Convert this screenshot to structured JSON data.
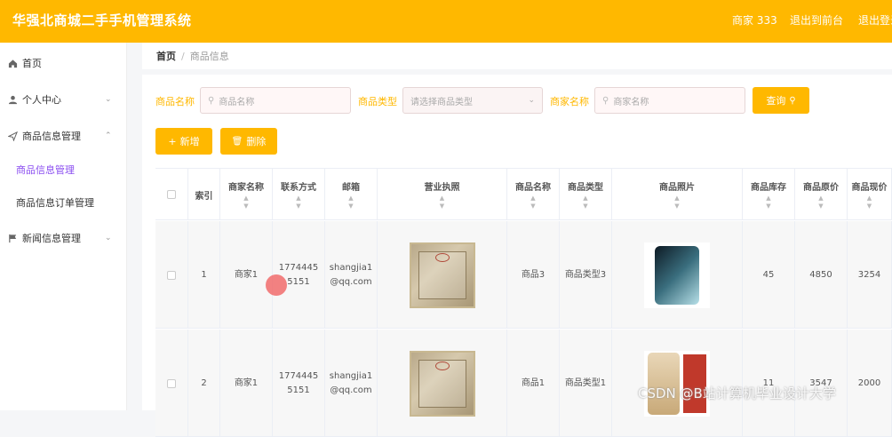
{
  "app": {
    "title": "华强北商城二手手机管理系统",
    "user_label": "商家 333",
    "front_label": "退出到前台",
    "logout_label": "退出登录"
  },
  "sidebar": {
    "items": [
      {
        "label": "首页",
        "icon": "home-icon"
      },
      {
        "label": "个人中心",
        "icon": "user-icon"
      },
      {
        "label": "商品信息管理",
        "icon": "send-icon"
      },
      {
        "label": "新闻信息管理",
        "icon": "flag-icon"
      }
    ],
    "sub_items": [
      {
        "label": "商品信息管理",
        "active": true
      },
      {
        "label": "商品信息订单管理",
        "active": false
      }
    ]
  },
  "breadcrumb": {
    "home": "首页",
    "sep": "/",
    "current": "商品信息"
  },
  "search": {
    "name_label": "商品名称",
    "name_placeholder": "商品名称",
    "type_label": "商品类型",
    "type_placeholder": "请选择商品类型",
    "merchant_label": "商家名称",
    "merchant_placeholder": "商家名称",
    "query_btn": "查询"
  },
  "actions": {
    "add_btn": "新增",
    "delete_btn": "删除"
  },
  "table": {
    "headers": [
      "索引",
      "商家名称",
      "联系方式",
      "邮箱",
      "营业执照",
      "商品名称",
      "商品类型",
      "商品照片",
      "商品库存",
      "商品原价",
      "商品现价"
    ],
    "rows": [
      {
        "index": "1",
        "merchant": "商家1",
        "phone": "17744455151",
        "email": "shangjia1@qq.com",
        "product": "商品3",
        "type": "商品类型3",
        "stock": "45",
        "original": "4850",
        "current": "3254"
      },
      {
        "index": "2",
        "merchant": "商家1",
        "phone": "17744455151",
        "email": "shangjia1@qq.com",
        "product": "商品1",
        "type": "商品类型1",
        "stock": "11",
        "original": "3547",
        "current": "2000"
      }
    ]
  },
  "watermark": "CSDN @B站计算机毕业设计大学",
  "colors": {
    "accent": "#ffb800",
    "active_menu": "#8a4df0"
  }
}
